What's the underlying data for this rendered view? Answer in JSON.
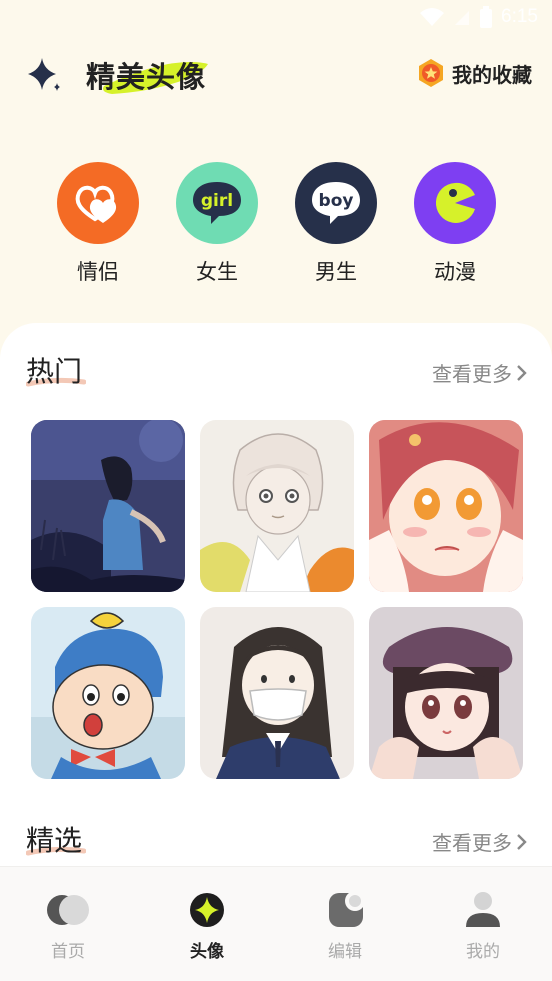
{
  "status": {
    "time": "6:15"
  },
  "header": {
    "title": "精美头像",
    "favorites_label": "我的收藏"
  },
  "categories": [
    {
      "label": "情侣",
      "color": "#f46b25",
      "icon": "couple-hearts-icon"
    },
    {
      "label": "女生",
      "color": "#6fdcb3",
      "icon": "girl-badge-icon"
    },
    {
      "label": "男生",
      "color": "#26304a",
      "icon": "boy-badge-icon"
    },
    {
      "label": "动漫",
      "color": "#7e3ff2",
      "icon": "pacman-icon"
    }
  ],
  "hot": {
    "title": "热门",
    "more_label": "查看更多",
    "avatars": [
      {
        "name": "night-girl-avatar"
      },
      {
        "name": "white-hair-boy-avatar"
      },
      {
        "name": "red-hair-girl-avatar"
      },
      {
        "name": "crayon-shin-avatar"
      },
      {
        "name": "mask-girl-avatar"
      },
      {
        "name": "beret-girl-avatar"
      }
    ]
  },
  "featured": {
    "title": "精选",
    "more_label": "查看更多"
  },
  "tabs": [
    {
      "label": "首页",
      "icon": "home-icon",
      "active": false
    },
    {
      "label": "头像",
      "icon": "avatar-star-icon",
      "active": true
    },
    {
      "label": "编辑",
      "icon": "edit-icon",
      "active": false
    },
    {
      "label": "我的",
      "icon": "profile-icon",
      "active": false
    }
  ],
  "colors": {
    "accent": "#d6f12a",
    "background": "#fdf9ec",
    "text": "#222222",
    "muted": "#888888"
  }
}
